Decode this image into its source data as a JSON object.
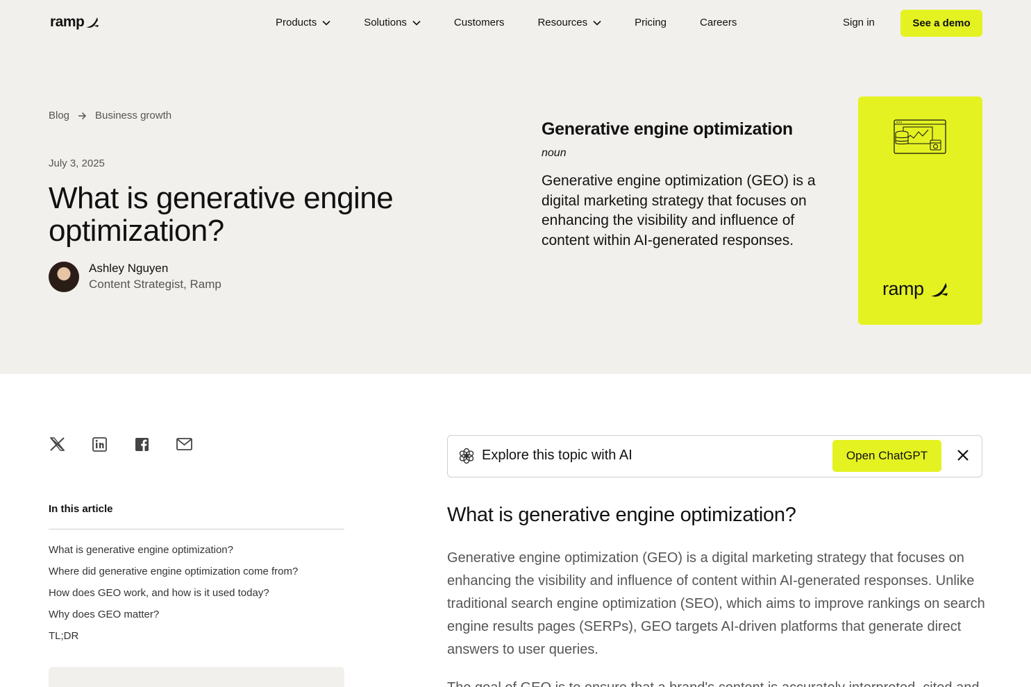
{
  "nav": {
    "logo": "ramp",
    "items": [
      {
        "label": "Products",
        "dropdown": true
      },
      {
        "label": "Solutions",
        "dropdown": true
      },
      {
        "label": "Customers",
        "dropdown": false
      },
      {
        "label": "Resources",
        "dropdown": true
      },
      {
        "label": "Pricing",
        "dropdown": false
      },
      {
        "label": "Careers",
        "dropdown": false
      }
    ],
    "sign_in": "Sign in",
    "demo": "See a demo"
  },
  "breadcrumb": {
    "items": [
      "Blog",
      "Business growth"
    ]
  },
  "article": {
    "date": "July 3, 2025",
    "title": "What is generative engine optimization?",
    "author": {
      "name": "Ashley Nguyen",
      "role": "Content Strategist, Ramp"
    }
  },
  "definition": {
    "term": "Generative engine optimization",
    "pos": "noun",
    "text": "Generative engine optimization (GEO) is a digital marketing strategy that focuses on enhancing the visibility and influence of content within AI-generated responses."
  },
  "card": {
    "logo": "ramp"
  },
  "share": {
    "icons": [
      "x-icon",
      "linkedin-icon",
      "facebook-icon",
      "email-icon"
    ]
  },
  "toc": {
    "title": "In this article",
    "items": [
      "What is generative engine optimization?",
      "Where did generative engine optimization come from?",
      "How does GEO work, and how is it used today?",
      "Why does GEO matter?",
      "TL;DR"
    ]
  },
  "ai_box": {
    "label": "Explore this topic with AI",
    "button": "Open ChatGPT"
  },
  "content": {
    "heading": "What is generative engine optimization?",
    "paragraph": "Generative engine optimization (GEO) is a digital marketing strategy that focuses on enhancing the visibility and influence of content within AI-generated responses. Unlike traditional search engine optimization (SEO), which aims to improve rankings on search engine results pages (SERPs), GEO targets AI-driven platforms that generate direct answers to user queries.",
    "paragraph2": "The goal of GEO is to ensure that a brand's content is accurately interpreted, cited and"
  },
  "colors": {
    "accent": "#e4f222",
    "hero_bg": "#f1f0ec",
    "text": "#111111",
    "muted": "#555555"
  }
}
